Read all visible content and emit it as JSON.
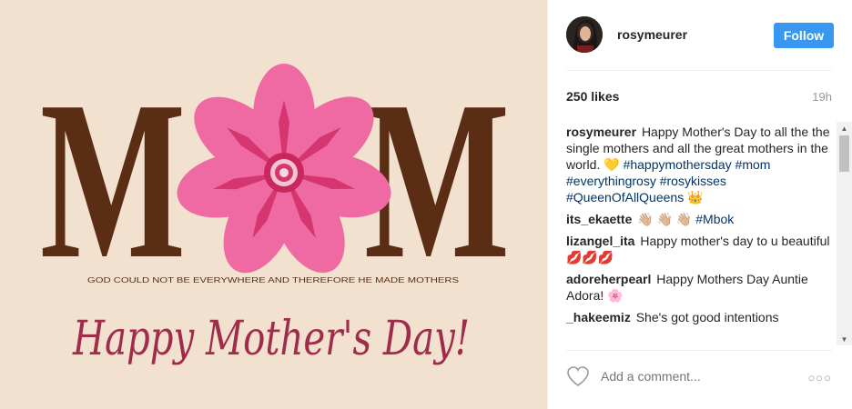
{
  "post_image": {
    "headline_left": "M",
    "headline_right": "M",
    "tagline": "GOD COULD NOT BE EVERYWHERE AND THEREFORE HE MADE MOTHERS",
    "script_text": "Happy Mother's Day!",
    "colors": {
      "background": "#f3e1d0",
      "letters": "#5a2d14",
      "petal": "#ef6aa2",
      "petal_dark": "#d5366f",
      "script": "#a02c4c"
    }
  },
  "header": {
    "username": "rosymeurer",
    "follow_label": "Follow",
    "avatar_icon": "profile-avatar"
  },
  "meta": {
    "likes": "250 likes",
    "time": "19h"
  },
  "caption": {
    "user": "rosymeurer",
    "text": "Happy Mother's Day to all the the single mothers and all the great mothers in the world.",
    "emoji_heart": "💛",
    "tags": [
      "#happymothersday",
      "#mom",
      "#everythingrosy",
      "#rosykisses",
      "#QueenOfAllQueens"
    ],
    "emoji_crown": "👑"
  },
  "comments": [
    {
      "user": "its_ekaette",
      "text": "👋🏼 👋🏼 👋🏼",
      "tag": "#Mbok"
    },
    {
      "user": "lizangel_ita",
      "text": "Happy mother's day to u beautiful💋💋💋"
    },
    {
      "user": "adoreherpearl",
      "text": "Happy Mothers Day Auntie Adora! 🌸"
    },
    {
      "user": "_hakeemiz",
      "text": "She's got good intentions"
    }
  ],
  "footer": {
    "comment_placeholder": "Add a comment...",
    "more_icon": "ellipsis-icon",
    "like_icon": "heart-icon"
  },
  "scrollbar": {
    "up_icon": "▲",
    "down_icon": "▼"
  }
}
